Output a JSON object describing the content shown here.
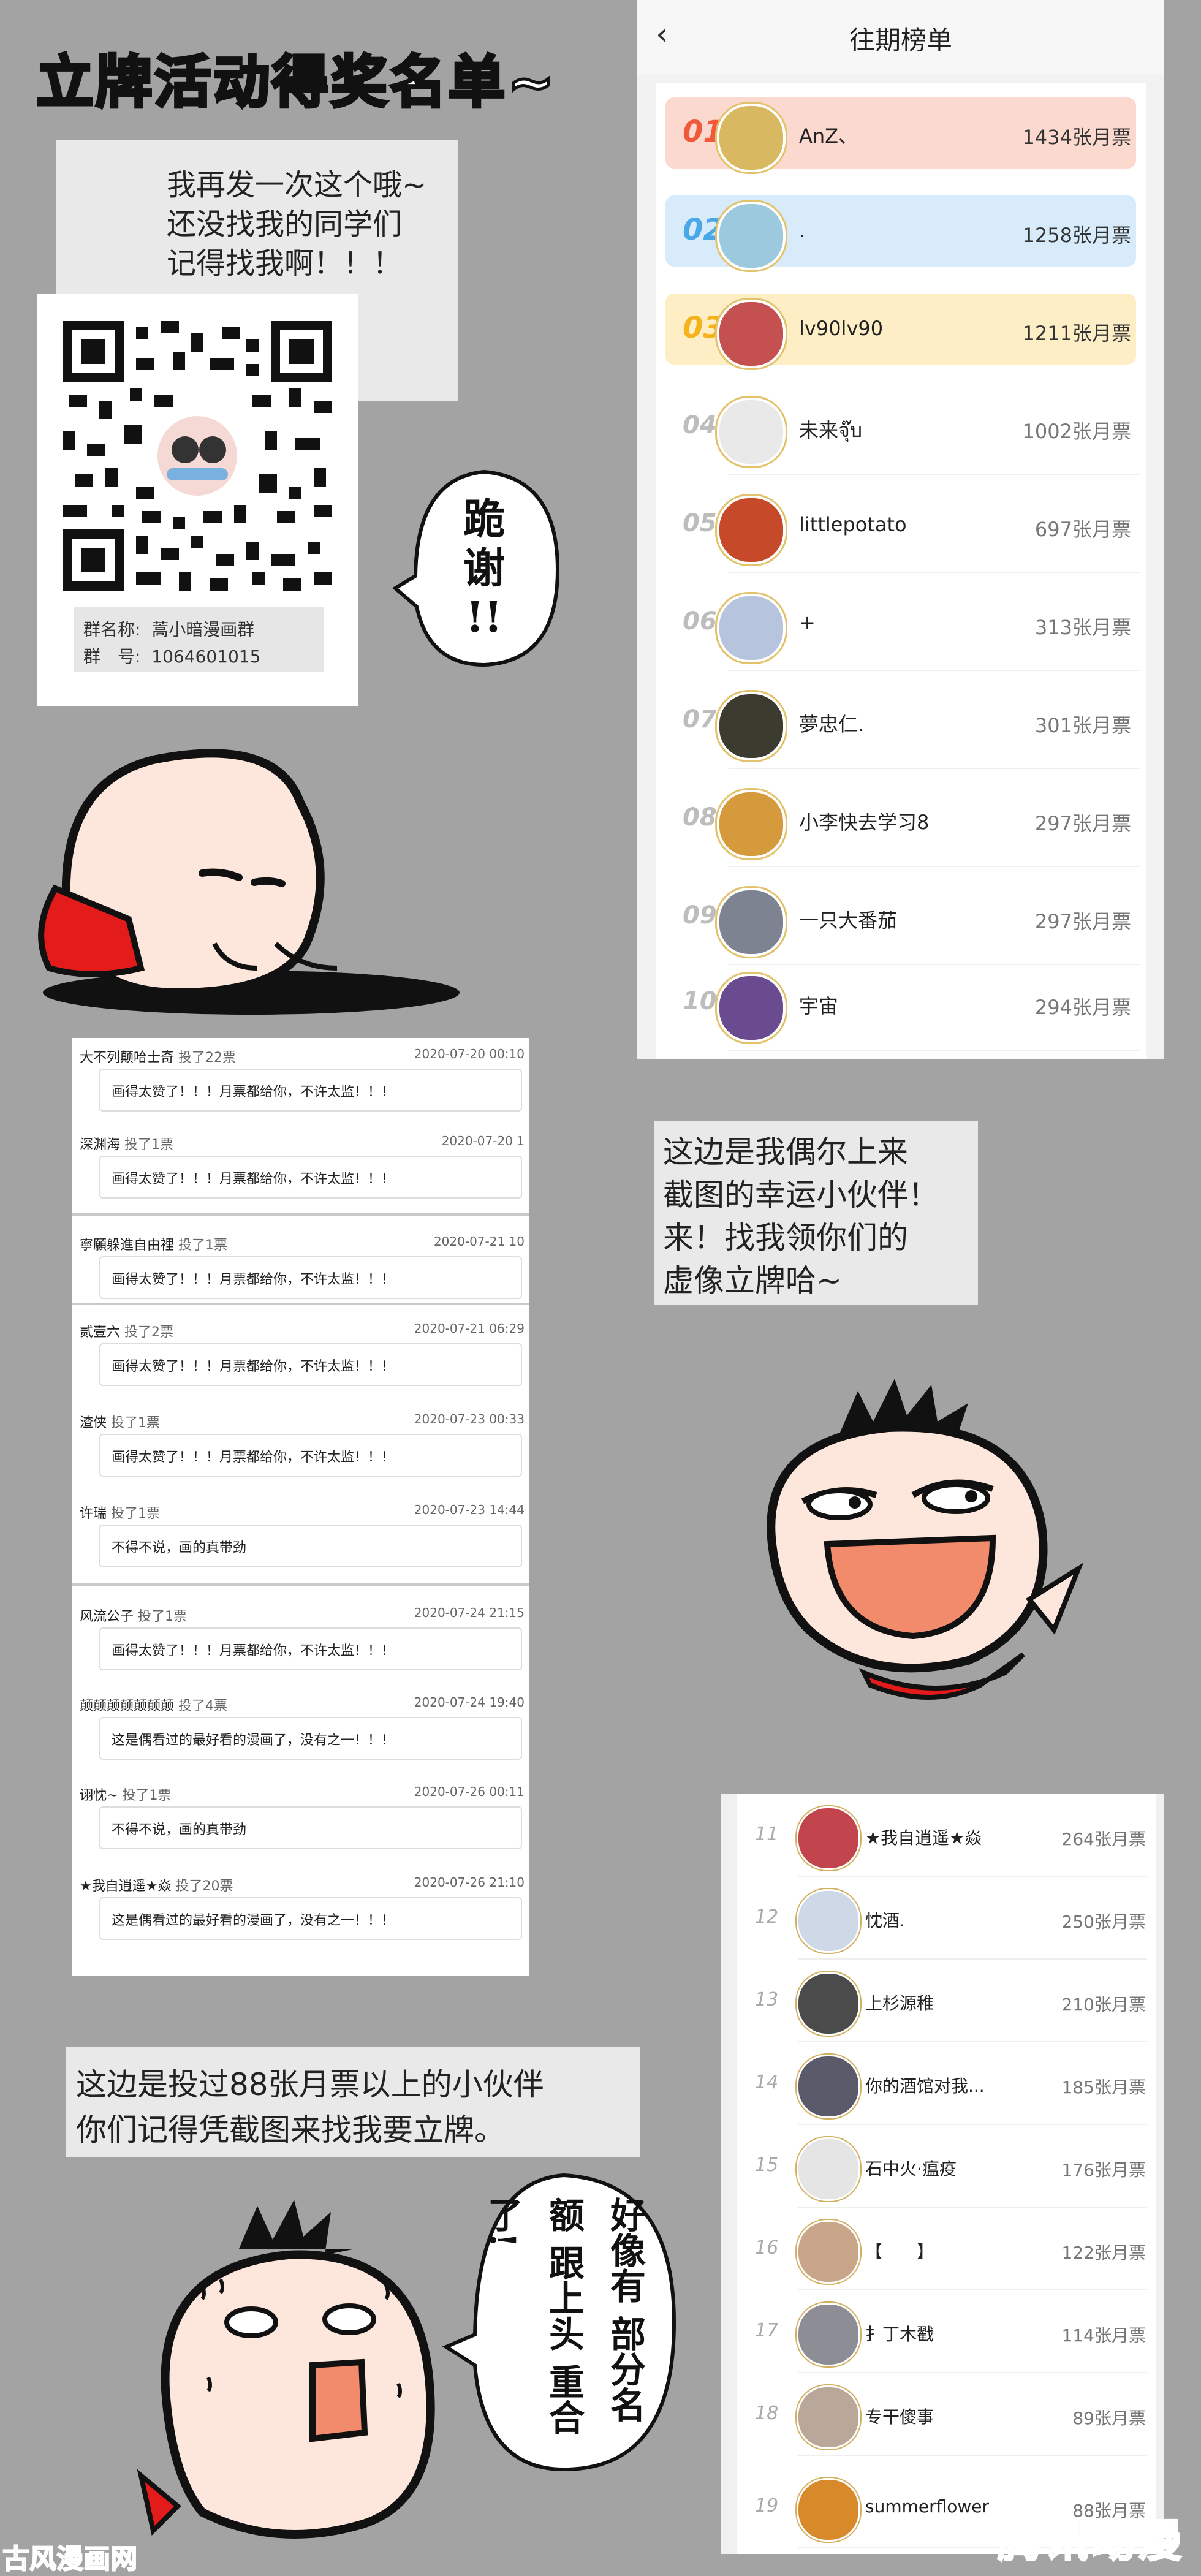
{
  "title": {
    "part1": "立牌活动",
    "part2": "得奖",
    "part3": "名单~"
  },
  "note1": {
    "lines": [
      "我再发一次这个哦~",
      "还没找我的同学们",
      "记得找我啊！！！"
    ]
  },
  "qr": {
    "group_name_label": "群名称:",
    "group_name": "蒿小暗漫画群",
    "group_no_label": "群　号:",
    "group_no": "1064601015"
  },
  "speech1": {
    "chars": [
      "跪",
      "谢",
      "!!"
    ]
  },
  "ranking": {
    "back_icon": "back-chevron-icon",
    "header": "往期榜单",
    "rows": [
      {
        "rank": "01",
        "name": "AnZ、",
        "tickets": "1434张月票",
        "bg": "#fbd9cf",
        "numColor": "#f05a3a",
        "avColor": "#d8b860"
      },
      {
        "rank": "02",
        "name": ".",
        "tickets": "1258张月票",
        "bg": "#d7ebfb",
        "numColor": "#4aa7e8",
        "avColor": "#9cc9de"
      },
      {
        "rank": "03",
        "name": "lv90lv90",
        "tickets": "1211张月票",
        "bg": "#fdeec6",
        "numColor": "#f4b21b",
        "avColor": "#c45050"
      },
      {
        "rank": "04",
        "name": "未来จุ๊บ",
        "tickets": "1002张月票",
        "bg": "",
        "numColor": "#bdbdbd",
        "avColor": "#e9e9e9"
      },
      {
        "rank": "05",
        "name": "littlepotato",
        "tickets": "697张月票",
        "bg": "",
        "numColor": "#bdbdbd",
        "avColor": "#c64a2a"
      },
      {
        "rank": "06",
        "name": "+",
        "tickets": "313张月票",
        "bg": "",
        "numColor": "#bdbdbd",
        "avColor": "#b7c4dd"
      },
      {
        "rank": "07",
        "name": "夢忠仁.",
        "tickets": "301张月票",
        "bg": "",
        "numColor": "#bdbdbd",
        "avColor": "#3b3b2f"
      },
      {
        "rank": "08",
        "name": "小李快去学习8",
        "tickets": "297张月票",
        "bg": "",
        "numColor": "#bdbdbd",
        "avColor": "#d59a3c"
      },
      {
        "rank": "09",
        "name": "一只大番茄",
        "tickets": "297张月票",
        "bg": "",
        "numColor": "#bdbdbd",
        "avColor": "#7d8390"
      },
      {
        "rank": "10",
        "name": "宇宙",
        "tickets": "294张月票",
        "bg": "",
        "numColor": "#bdbdbd",
        "avColor": "#6a4b8f"
      }
    ]
  },
  "comments": [
    {
      "user": "大不列颠哈士奇",
      "vote": "投了22票",
      "time": "2020-07-20 00:10",
      "text": "画得太赞了！！！月票都给你，不许太监！！！"
    },
    {
      "user": "深渊海",
      "vote": "投了1票",
      "time": "2020-07-20 1",
      "text": "画得太赞了！！！月票都给你，不许太监！！！"
    },
    {
      "user": "寧願躲進自由裡",
      "vote": "投了1票",
      "time": "2020-07-21 10",
      "text": "画得太赞了！！！月票都给你，不许太监！！！"
    },
    {
      "user": "贰壹六",
      "vote": "投了2票",
      "time": "2020-07-21 06:29",
      "text": "画得太赞了！！！月票都给你，不许太监！！！"
    },
    {
      "user": "渣侠",
      "vote": "投了1票",
      "time": "2020-07-23 00:33",
      "text": "画得太赞了！！！月票都给你，不许太监！！！"
    },
    {
      "user": "许瑞",
      "vote": "投了1票",
      "time": "2020-07-23 14:44",
      "text": "不得不说，画的真带劲"
    },
    {
      "user": "风流公子",
      "vote": "投了1票",
      "time": "2020-07-24 21:15",
      "text": "画得太赞了！！！月票都给你，不许太监！！！"
    },
    {
      "user": "颠颠颠颠颠颠颠",
      "vote": "投了4票",
      "time": "2020-07-24 19:40",
      "text": "这是偶看过的最好看的漫画了，没有之一！！！"
    },
    {
      "user": "诩忱~",
      "vote": "投了1票",
      "time": "2020-07-26 00:11",
      "text": "不得不说，画的真带劲"
    },
    {
      "user": "★我自逍遥★焱",
      "vote": "投了20票",
      "time": "2020-07-26 21:10",
      "text": "这是偶看过的最好看的漫画了，没有之一！！！"
    }
  ],
  "note2": {
    "lines": [
      "这边是我偶尔上来",
      "截图的幸运小伙伴！",
      "来！找我领你们的",
      "虚像立牌哈~"
    ]
  },
  "note3": {
    "lines": [
      "这边是投过88张月票以上的小伙伴",
      "你们记得凭截图来找我要立牌。"
    ]
  },
  "speech2": {
    "cols": [
      "好像有",
      "部分名额",
      "跟上头",
      "重合了!"
    ]
  },
  "ranking2": {
    "rows": [
      {
        "rank": "11",
        "name": "★我自逍遥★焱",
        "tickets": "264张月票",
        "avColor": "#c2444c"
      },
      {
        "rank": "12",
        "name": "忱酒.",
        "tickets": "250张月票",
        "avColor": "#cfd8e6"
      },
      {
        "rank": "13",
        "name": "上杉源稚",
        "tickets": "210张月票",
        "avColor": "#4b4b4b"
      },
      {
        "rank": "14",
        "name": "你的酒馆对我...",
        "tickets": "185张月票",
        "avColor": "#5a5a6a"
      },
      {
        "rank": "15",
        "name": "石中火·瘟疫",
        "tickets": "176张月票",
        "avColor": "#e5e5e5"
      },
      {
        "rank": "16",
        "name": "【　　】",
        "tickets": "122张月票",
        "avColor": "#c9a58a"
      },
      {
        "rank": "17",
        "name": "扌丁木戳",
        "tickets": "114张月票",
        "avColor": "#8d8d95"
      },
      {
        "rank": "18",
        "name": "专干傻事",
        "tickets": "89张月票",
        "avColor": "#b9a79a"
      },
      {
        "rank": "19",
        "name": "summerflower",
        "tickets": "88张月票",
        "avColor": "#d88a2a"
      }
    ]
  },
  "watermark": {
    "left": "古风漫画网",
    "right": "腾讯动漫"
  }
}
